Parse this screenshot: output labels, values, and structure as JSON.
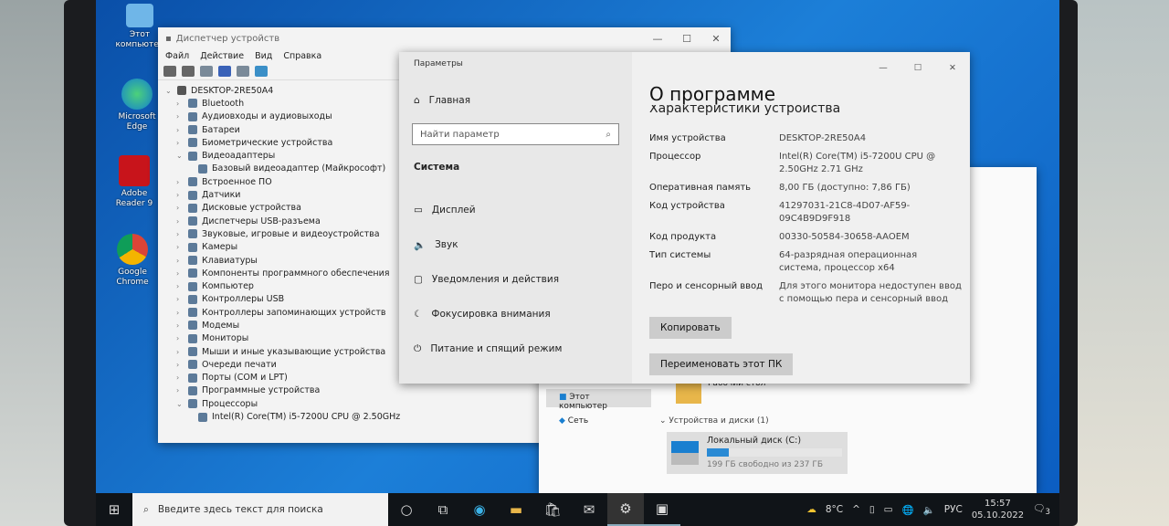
{
  "desktop": {
    "icons": [
      {
        "label": "Этот компьютер"
      },
      {
        "label": "Microsoft Edge"
      },
      {
        "label": "Adobe Reader 9"
      },
      {
        "label": "Google Chrome"
      }
    ]
  },
  "device_manager": {
    "title": "Диспетчер устройств",
    "menu": [
      "Файл",
      "Действие",
      "Вид",
      "Справка"
    ],
    "root": "DESKTOP-2RE50A4",
    "nodes": [
      {
        "label": "Bluetooth",
        "expanded": false,
        "level": 1
      },
      {
        "label": "Аудиовходы и аудиовыходы",
        "expanded": false,
        "level": 1
      },
      {
        "label": "Батареи",
        "expanded": false,
        "level": 1
      },
      {
        "label": "Биометрические устройства",
        "expanded": false,
        "level": 1
      },
      {
        "label": "Видеоадаптеры",
        "expanded": true,
        "level": 1
      },
      {
        "label": "Базовый видеоадаптер (Майкрософт)",
        "level": 2
      },
      {
        "label": "Встроенное ПО",
        "expanded": false,
        "level": 1
      },
      {
        "label": "Датчики",
        "expanded": false,
        "level": 1
      },
      {
        "label": "Дисковые устройства",
        "expanded": false,
        "level": 1
      },
      {
        "label": "Диспетчеры USB-разъема",
        "expanded": false,
        "level": 1
      },
      {
        "label": "Звуковые, игровые и видеоустройства",
        "expanded": false,
        "level": 1
      },
      {
        "label": "Камеры",
        "expanded": false,
        "level": 1
      },
      {
        "label": "Клавиатуры",
        "expanded": false,
        "level": 1
      },
      {
        "label": "Компоненты программного обеспечения",
        "expanded": false,
        "level": 1
      },
      {
        "label": "Компьютер",
        "expanded": false,
        "level": 1
      },
      {
        "label": "Контроллеры USB",
        "expanded": false,
        "level": 1
      },
      {
        "label": "Контроллеры запоминающих устройств",
        "expanded": false,
        "level": 1
      },
      {
        "label": "Модемы",
        "expanded": false,
        "level": 1
      },
      {
        "label": "Мониторы",
        "expanded": false,
        "level": 1
      },
      {
        "label": "Мыши и иные указывающие устройства",
        "expanded": false,
        "level": 1
      },
      {
        "label": "Очереди печати",
        "expanded": false,
        "level": 1
      },
      {
        "label": "Порты (COM и LPT)",
        "expanded": false,
        "level": 1
      },
      {
        "label": "Программные устройства",
        "expanded": false,
        "level": 1
      },
      {
        "label": "Процессоры",
        "expanded": true,
        "level": 1
      },
      {
        "label": "Intel(R) Core(TM) i5-7200U CPU @ 2.50GHz",
        "level": 2
      }
    ]
  },
  "settings": {
    "title": "Параметры",
    "home": "Главная",
    "search_placeholder": "Найти параметр",
    "section": "Система",
    "nav": [
      "Дисплей",
      "Звук",
      "Уведомления и действия",
      "Фокусировка внимания",
      "Питание и спящий режим"
    ],
    "page_title": "О программе",
    "subtitle": "Характеристики устройства",
    "specs": [
      {
        "k": "Имя устройства",
        "v": "DESKTOP-2RE50A4"
      },
      {
        "k": "Процессор",
        "v": "Intel(R) Core(TM) i5-7200U CPU @ 2.50GHz   2.71 GHz"
      },
      {
        "k": "Оперативная память",
        "v": "8,00 ГБ (доступно: 7,86 ГБ)"
      },
      {
        "k": "Код устройства",
        "v": "41297031-21C8-4D07-AF59-09C4B9D9F918"
      },
      {
        "k": "Код продукта",
        "v": "00330-50584-30658-AAOEM"
      },
      {
        "k": "Тип системы",
        "v": "64-разрядная операционная система, процессор x64"
      },
      {
        "k": "Перо и сенсорный ввод",
        "v": "Для этого монитора недоступен ввод с помощью пера и сенсорный ввод"
      }
    ],
    "copy_button": "Копировать",
    "rename_button": "Переименовать этот ПК"
  },
  "explorer": {
    "nav": [
      "Этот компьютер",
      "Сеть"
    ],
    "folder": "Рабочий стол",
    "group": "Устройства и диски (1)",
    "drive": {
      "name": "Локальный диск (C:)",
      "free": "199 ГБ свободно из 237 ГБ",
      "used_fraction": 0.16
    }
  },
  "taskbar": {
    "search_placeholder": "Введите здесь текст для поиска",
    "weather": "8°C",
    "lang": "РУС",
    "time": "15:57",
    "date": "05.10.2022",
    "notifications": "3"
  },
  "colors": {
    "accent": "#1a7fd0",
    "taskbar": "#101418"
  }
}
